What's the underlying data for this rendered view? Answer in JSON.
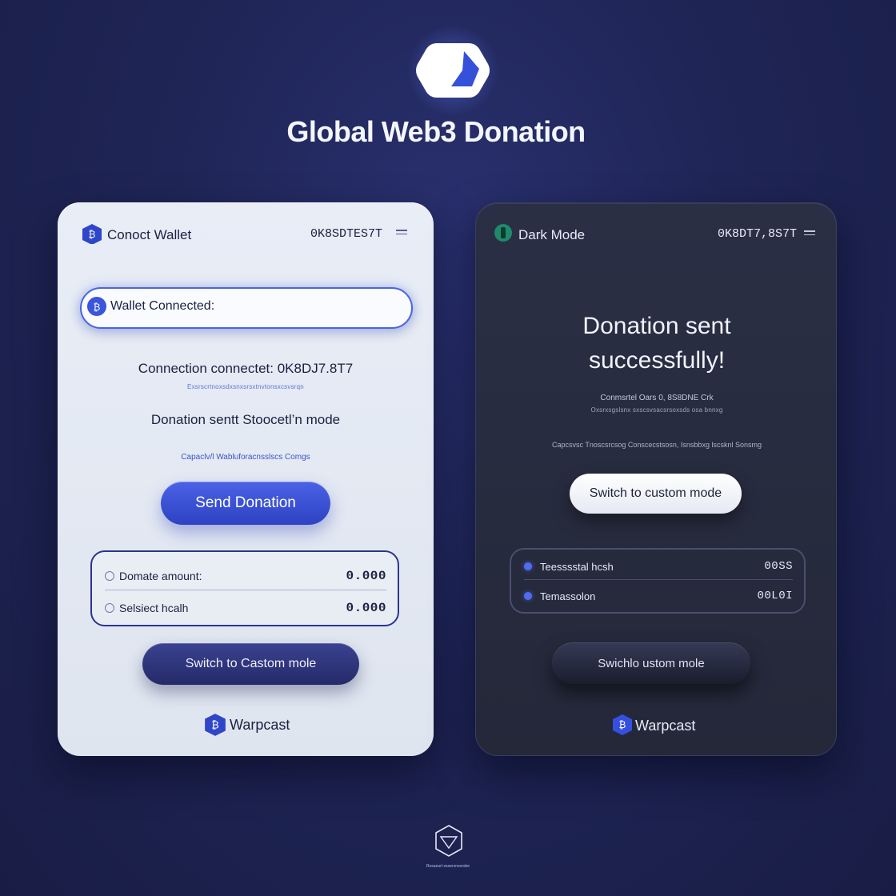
{
  "app": {
    "title": "Global Web3 Donation",
    "logo_icon": "app-logo-icon",
    "accent": "#3d55d8"
  },
  "light_card": {
    "header_title": "Conoct Wallet",
    "header_address": "0K8SDTES7T",
    "status_pill": "Wallet Connected:",
    "connection_text": "Connection connectet: 0K8DJ7.8T7",
    "connection_subtext": "Exsrscrtnoxsdxsnxsrsxtnvtonsxcsvsrqn",
    "donation_text": "Donation sentt  Stoocetl’n mode",
    "mode_subtext": "Capaclv/l Wabluforacnsslscs Comgs",
    "send_button": "Send Donation",
    "rows": [
      {
        "label": "Domate amount:",
        "value": "0.000"
      },
      {
        "label": "Selsiect hcalh",
        "value": "0.000"
      }
    ],
    "switch_button": "Switch to Castom mole",
    "footer_brand": "Warpcast"
  },
  "dark_card": {
    "header_title": "Dark Mode",
    "header_address": "0K8DT7,8S7T",
    "headline_line1": "Donation sent",
    "headline_line2": "successfully!",
    "sub_text": "Conmsrtel Oars 0, 8S8DNE Crk",
    "sub_small": "Oxsrxsgslsnx sxscsvsacsrsoxsds osa bnnxg",
    "mode_text": "Capcsvsc  Tnoscsrcsog  Conscecstsosn, Isnsbbxg lscsknl  Sonsmg",
    "switch_button_top": "Switch to custom mode",
    "rows": [
      {
        "label": "Teesssstal hcsh",
        "value": "00SS"
      },
      {
        "label": "Temassolon",
        "value": "00L0I"
      }
    ],
    "switch_button_bottom": "Swichlo ustom mole",
    "footer_brand": "Warpcast"
  },
  "bottom_caption": "Rnsaeurl-xsoerxnesrsbe"
}
